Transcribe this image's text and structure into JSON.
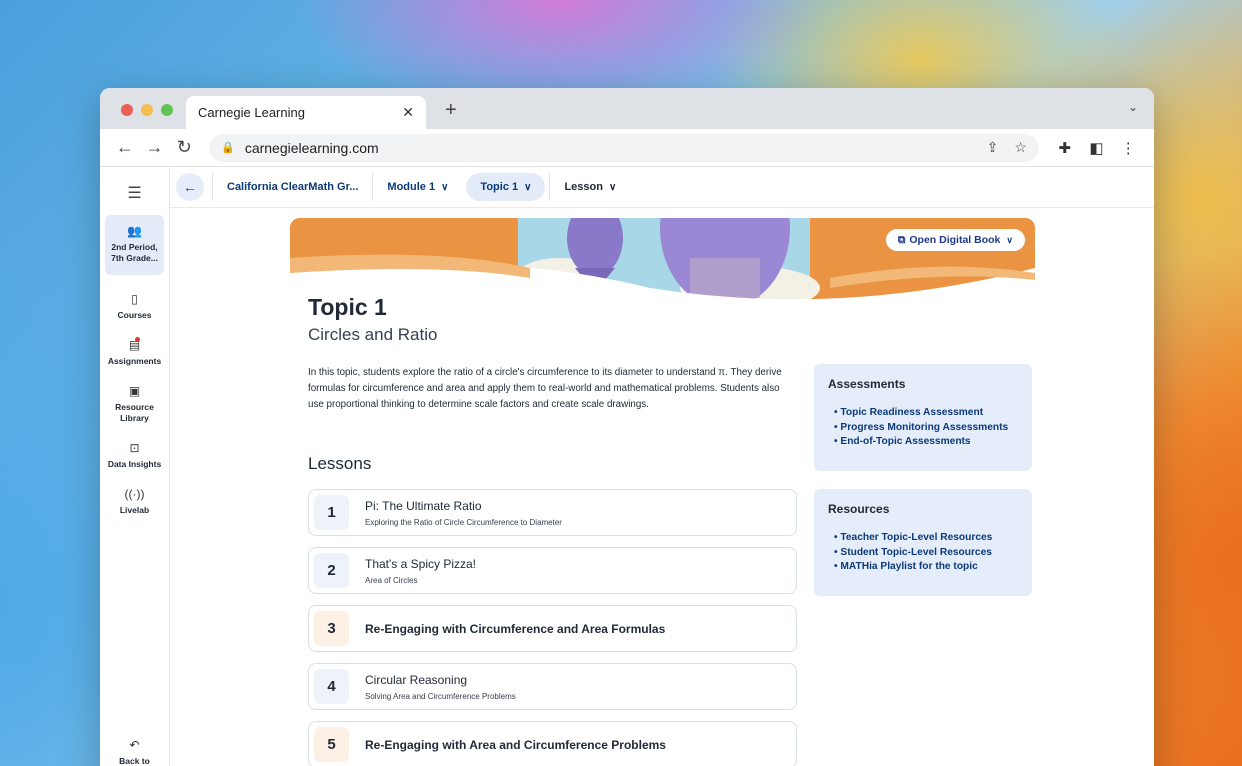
{
  "browser": {
    "tab_title": "Carnegie Learning",
    "url": "carnegielearning.com"
  },
  "sidebar": {
    "class_label": "2nd Period, 7th Grade...",
    "items": [
      {
        "label": "Courses",
        "icon": "book-icon"
      },
      {
        "label": "Assignments",
        "icon": "clipboard-icon"
      },
      {
        "label": "Resource Library",
        "icon": "library-icon"
      },
      {
        "label": "Data Insights",
        "icon": "chart-icon"
      },
      {
        "label": "Livelab",
        "icon": "broadcast-icon"
      }
    ],
    "back_label": "Back to Portal"
  },
  "breadcrumb": {
    "course": "California ClearMath Gr...",
    "module": "Module 1",
    "topic": "Topic 1",
    "lesson": "Lesson"
  },
  "banner": {
    "open_book": "Open Digital Book"
  },
  "topic": {
    "title": "Topic 1",
    "subtitle": "Circles and Ratio",
    "description": "In this topic, students explore the ratio of a circle's circumference to its diameter to understand π. They derive formulas for circumference and area and apply them to real-world and mathematical problems. Students also use proportional thinking to determine scale factors and create scale drawings."
  },
  "lessons_heading": "Lessons",
  "lessons": [
    {
      "num": "1",
      "title": "Pi: The Ultimate Ratio",
      "subtitle": "Exploring the Ratio of Circle Circumference to Diameter"
    },
    {
      "num": "2",
      "title": "That's a Spicy Pizza!",
      "subtitle": "Area of Circles"
    },
    {
      "num": "3",
      "title": "Re-Engaging with Circumference and Area Formulas",
      "subtitle": ""
    },
    {
      "num": "4",
      "title": "Circular Reasoning",
      "subtitle": "Solving Area and Circumference Problems"
    },
    {
      "num": "5",
      "title": "Re-Engaging with Area and Circumference Problems",
      "subtitle": ""
    }
  ],
  "assessments": {
    "heading": "Assessments",
    "links": [
      "Topic Readiness Assessment",
      "Progress Monitoring Assessments",
      "End-of-Topic Assessments"
    ]
  },
  "resources": {
    "heading": "Resources",
    "links": [
      "Teacher Topic-Level Resources",
      "Student Topic-Level Resources",
      "MATHia Playlist for the topic"
    ]
  }
}
